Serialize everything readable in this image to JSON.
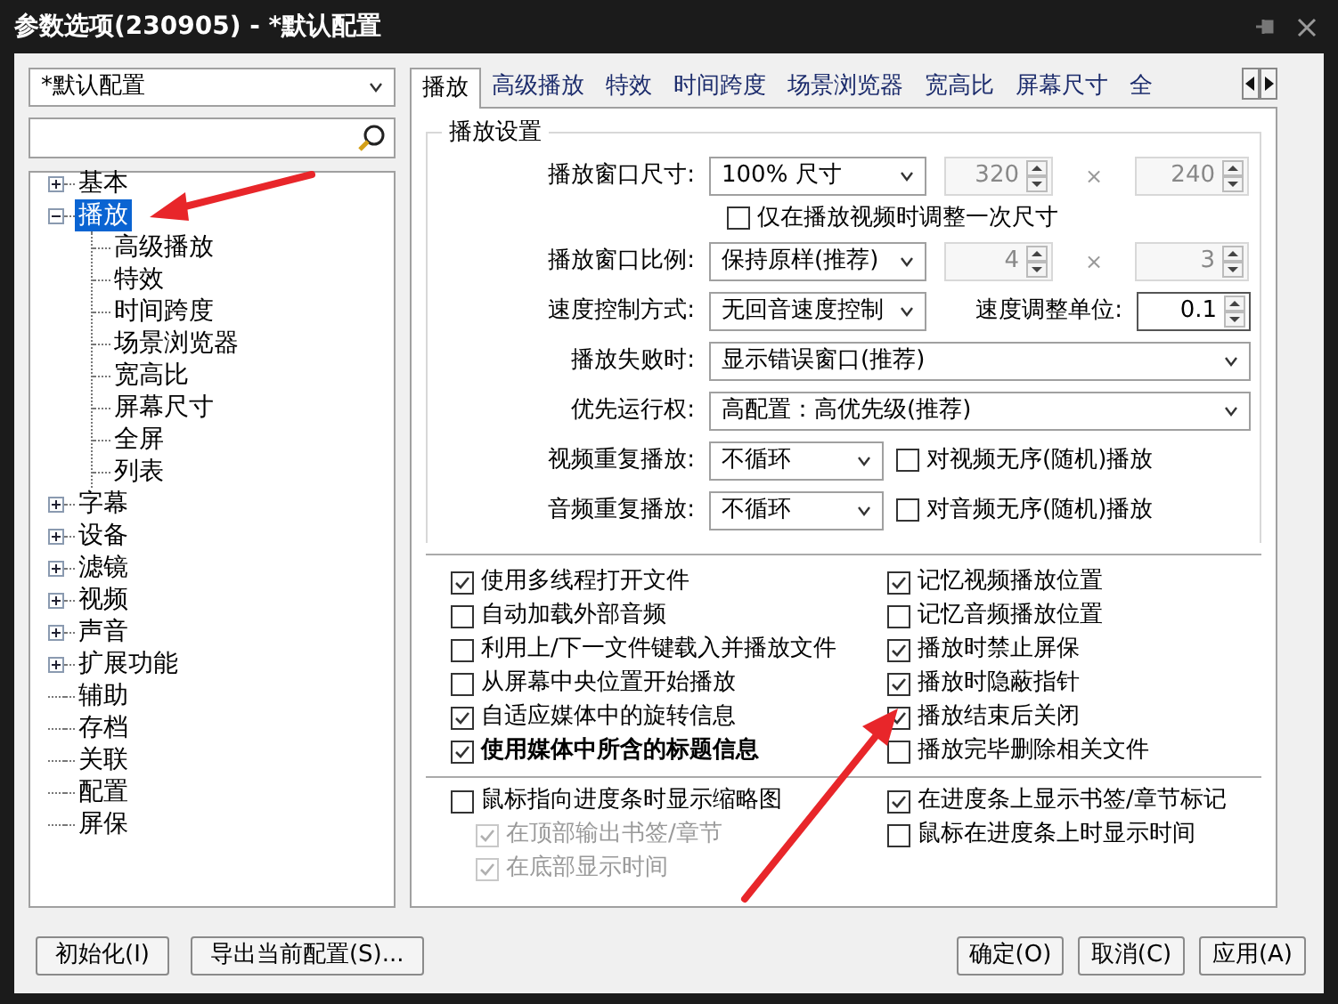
{
  "window": {
    "title": "参数选项(230905) - *默认配置"
  },
  "profile_select": {
    "value": "*默认配置"
  },
  "tree": [
    {
      "label": "基本",
      "expanded": false,
      "selected": false
    },
    {
      "label": "播放",
      "expanded": true,
      "selected": true,
      "children": [
        {
          "label": "高级播放",
          "selected": false
        },
        {
          "label": "特效",
          "selected": false
        },
        {
          "label": "时间跨度",
          "selected": false
        },
        {
          "label": "场景浏览器",
          "selected": false
        },
        {
          "label": "宽高比",
          "selected": false
        },
        {
          "label": "屏幕尺寸",
          "selected": false
        },
        {
          "label": "全屏",
          "selected": false
        },
        {
          "label": "列表",
          "selected": false
        }
      ]
    },
    {
      "label": "字幕",
      "expanded": false,
      "selected": false
    },
    {
      "label": "设备",
      "expanded": false,
      "selected": false
    },
    {
      "label": "滤镜",
      "expanded": false,
      "selected": false
    },
    {
      "label": "视频",
      "expanded": false,
      "selected": false
    },
    {
      "label": "声音",
      "expanded": false,
      "selected": false
    },
    {
      "label": "扩展功能",
      "expanded": false,
      "selected": false
    },
    {
      "label": "辅助",
      "selected": false
    },
    {
      "label": "存档",
      "selected": false
    },
    {
      "label": "关联",
      "selected": false
    },
    {
      "label": "配置",
      "selected": false
    },
    {
      "label": "屏保",
      "selected": false
    }
  ],
  "tabs": [
    {
      "label": "播放",
      "selected": true
    },
    {
      "label": "高级播放",
      "selected": false
    },
    {
      "label": "特效",
      "selected": false
    },
    {
      "label": "时间跨度",
      "selected": false
    },
    {
      "label": "场景浏览器",
      "selected": false
    },
    {
      "label": "宽高比",
      "selected": false
    },
    {
      "label": "屏幕尺寸",
      "selected": false
    },
    {
      "label": "全",
      "selected": false
    }
  ],
  "settings": {
    "title": "播放设置",
    "rows": [
      {
        "kind": "pair",
        "label": "播放窗口尺寸:",
        "select": "100% 尺寸",
        "values": [
          "320",
          "240"
        ],
        "separator": "×",
        "disabled": true
      },
      {
        "kind": "check",
        "label": "仅在播放视频时调整一次尺寸",
        "checked": false
      },
      {
        "kind": "pair",
        "label": "播放窗口比例:",
        "select": "保持原样(推荐)",
        "values": [
          "4",
          "3"
        ],
        "separator": "×",
        "disabled": true
      },
      {
        "kind": "speed",
        "label": "速度控制方式:",
        "select": "无回音速度控制",
        "unit_label": "速度调整单位:",
        "unit_value": "0.1"
      },
      {
        "kind": "wide",
        "label": "播放失败时:",
        "select": "显示错误窗口(推荐)"
      },
      {
        "kind": "wide",
        "label": "优先运行权:",
        "select": "高配置：高优先级(推荐)"
      },
      {
        "kind": "repeat",
        "label": "视频重复播放:",
        "select": "不循环",
        "option": "对视频无序(随机)播放",
        "checked": false
      },
      {
        "kind": "repeat",
        "label": "音频重复播放:",
        "select": "不循环",
        "option": "对音频无序(随机)播放",
        "checked": false
      }
    ]
  },
  "options_left": [
    {
      "label": "使用多线程打开文件",
      "checked": true,
      "bold": false
    },
    {
      "label": "自动加载外部音频",
      "checked": false,
      "bold": false
    },
    {
      "label": "利用上/下一文件键载入并播放文件",
      "checked": false,
      "bold": false
    },
    {
      "label": "从屏幕中央位置开始播放",
      "checked": false,
      "bold": false
    },
    {
      "label": "自适应媒体中的旋转信息",
      "checked": true,
      "bold": false
    },
    {
      "label": "使用媒体中所含的标题信息",
      "checked": true,
      "bold": true
    }
  ],
  "options_right": [
    {
      "label": "记忆视频播放位置",
      "checked": true,
      "bold": false
    },
    {
      "label": "记忆音频播放位置",
      "checked": false,
      "bold": false
    },
    {
      "label": "播放时禁止屏保",
      "checked": true,
      "bold": false
    },
    {
      "label": "播放时隐蔽指针",
      "checked": true,
      "bold": false
    },
    {
      "label": "播放结束后关闭",
      "checked": true,
      "bold": false
    },
    {
      "label": "播放完毕删除相关文件",
      "checked": false,
      "bold": false
    }
  ],
  "progress_left": [
    {
      "label": "鼠标指向进度条时显示缩略图",
      "checked": false,
      "disabled": false,
      "children": [
        {
          "label": "在顶部输出书签/章节",
          "checked": true,
          "disabled": true
        },
        {
          "label": "在底部显示时间",
          "checked": true,
          "disabled": true
        }
      ]
    }
  ],
  "progress_right": [
    {
      "label": "在进度条上显示书签/章节标记",
      "checked": true,
      "disabled": false
    },
    {
      "label": "鼠标在进度条上时显示时间",
      "checked": false,
      "disabled": false
    }
  ],
  "footer_left": [
    "初始化(I)",
    "导出当前配置(S)..."
  ],
  "footer_right": [
    "确定(O)",
    "取消(C)",
    "应用(A)"
  ]
}
